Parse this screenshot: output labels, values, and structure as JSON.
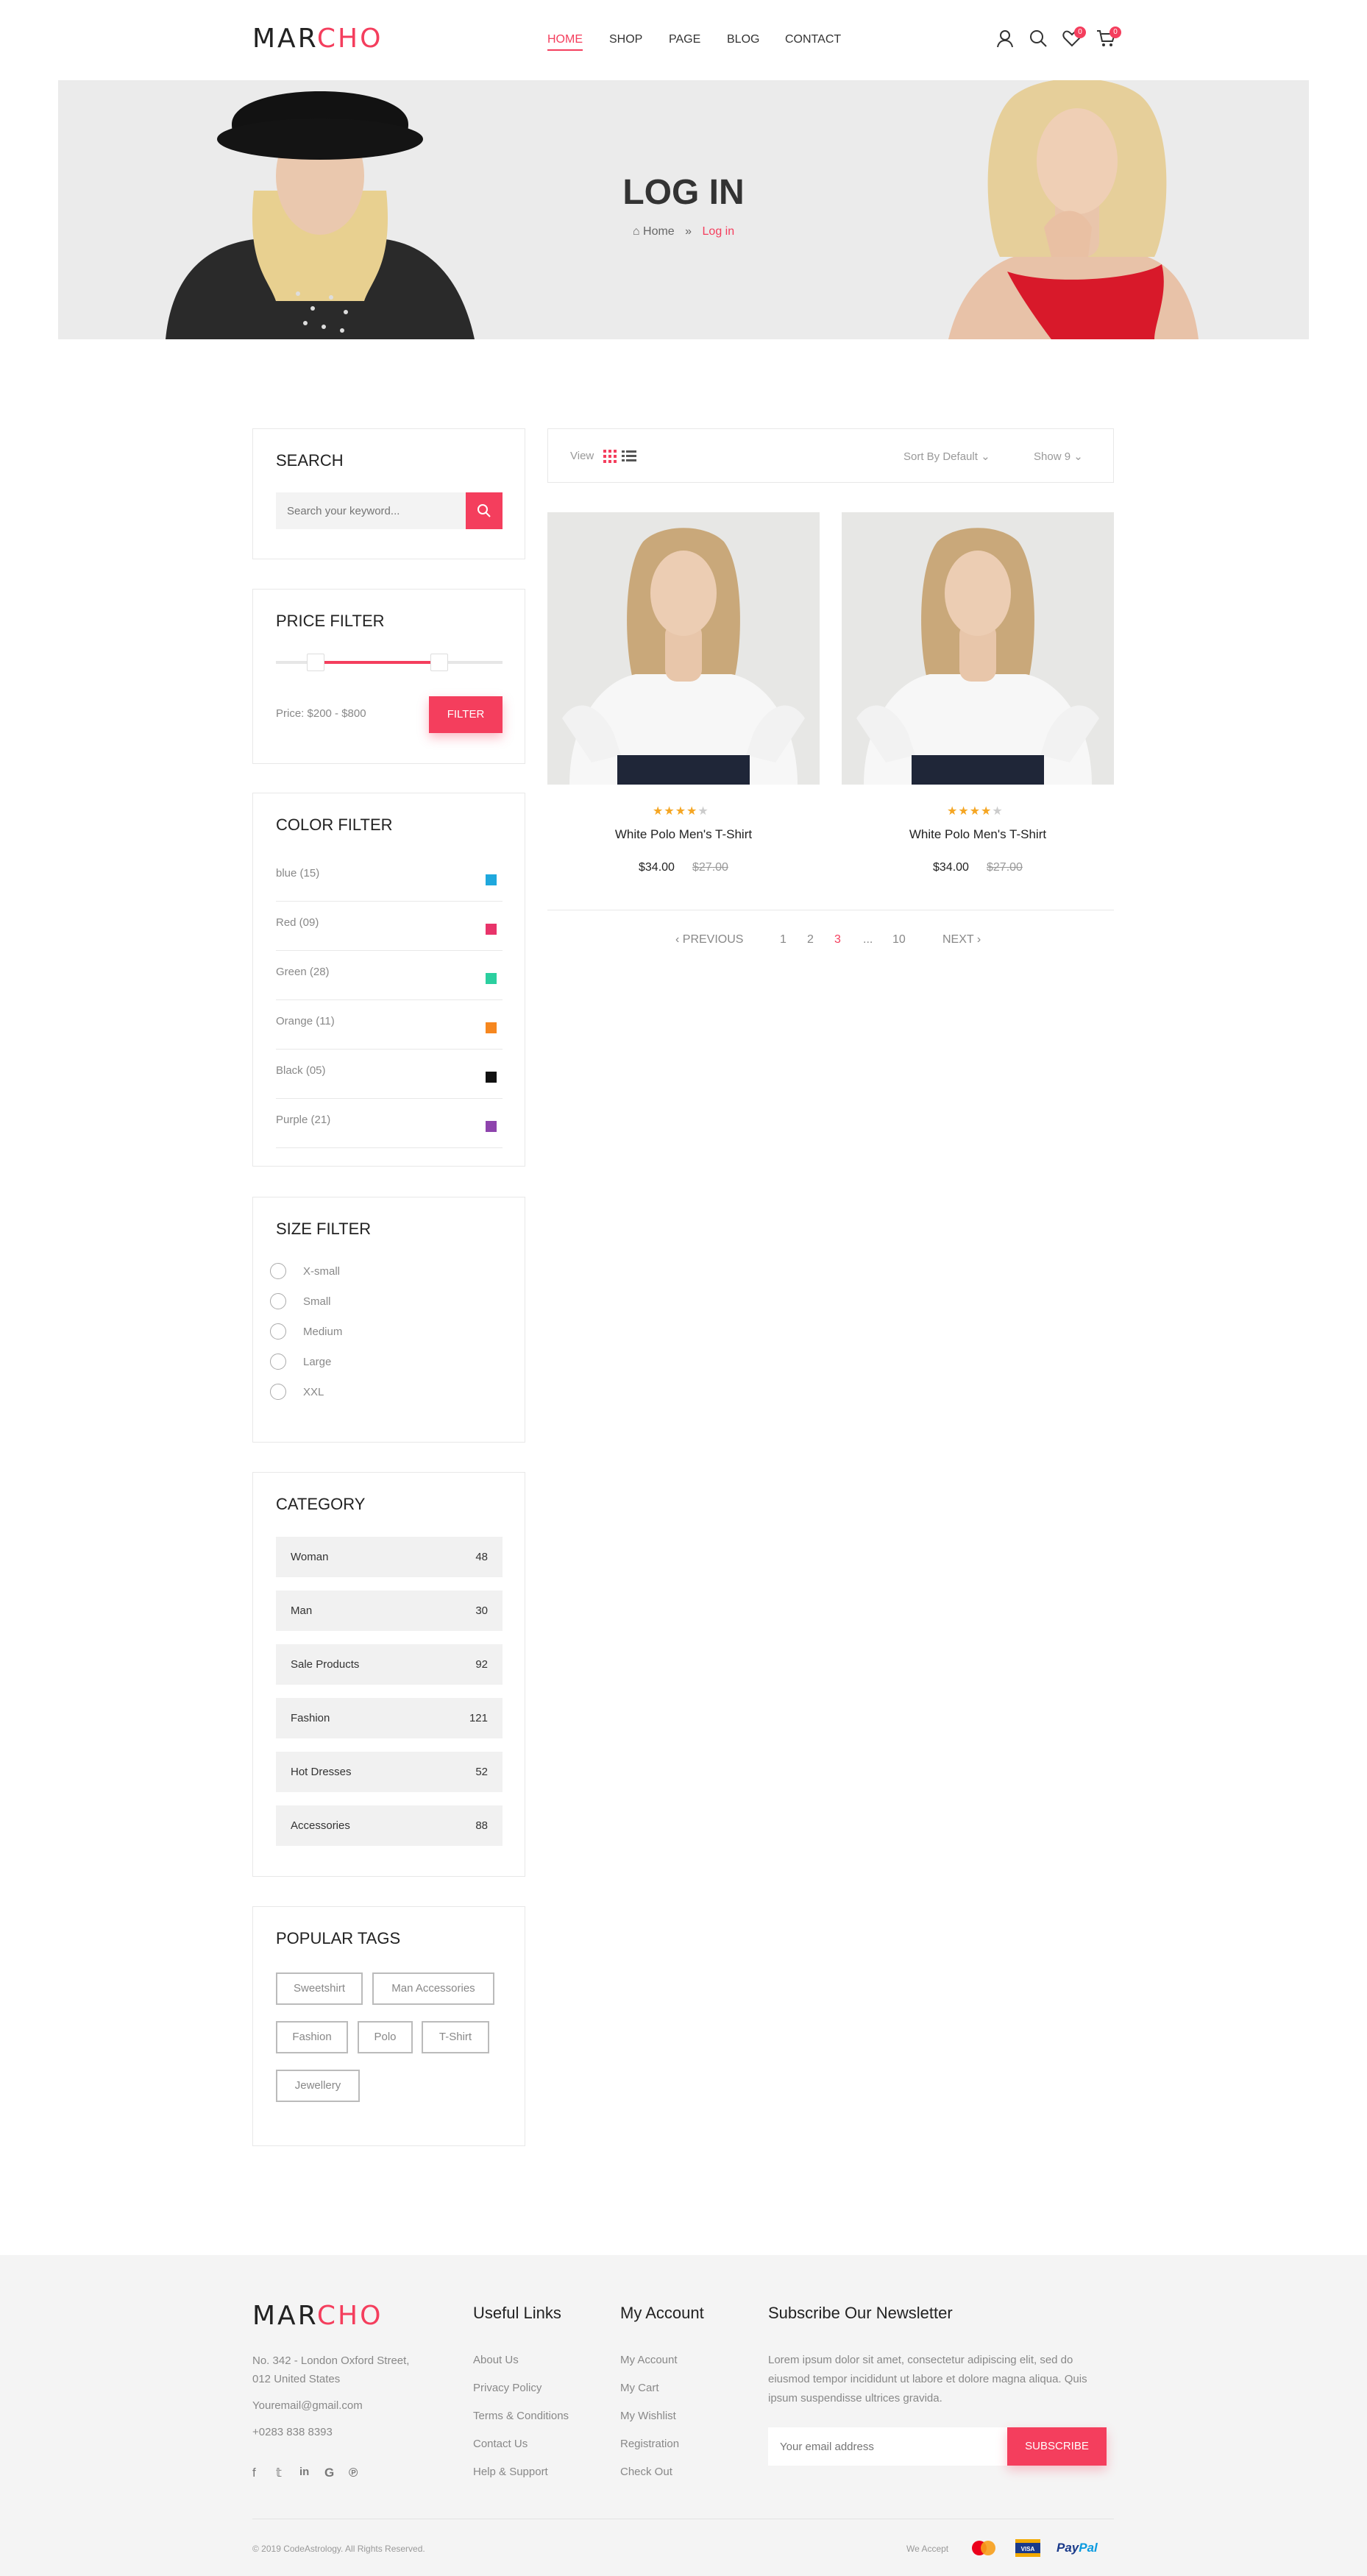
{
  "header": {
    "logo": {
      "part1": "MAR",
      "part2": "CHO"
    },
    "nav": [
      "HOME",
      "SHOP",
      "PAGE",
      "BLOG",
      "CONTACT"
    ],
    "active_nav": "HOME",
    "wishlist_count": "0",
    "cart_count": "0"
  },
  "banner": {
    "title": "LOG IN",
    "breadcrumb_home": "Home",
    "breadcrumb_current": "Log in"
  },
  "sidebar": {
    "search": {
      "title": "SEARCH",
      "placeholder": "Search your keyword..."
    },
    "price": {
      "title": "PRICE FILTER",
      "label": "Price: $200 - $800",
      "button": "FILTER",
      "range_low_fraction": 0.22,
      "range_high_fraction": 0.76
    },
    "color": {
      "title": "COLOR FILTER",
      "items": [
        {
          "label": "blue (15)",
          "color": "#1fa8dd"
        },
        {
          "label": "Red (09)",
          "color": "#e8346a"
        },
        {
          "label": "Green (28)",
          "color": "#2bcf9f"
        },
        {
          "label": "Orange (11)",
          "color": "#f6871f"
        },
        {
          "label": "Black (05)",
          "color": "#111111"
        },
        {
          "label": "Purple (21)",
          "color": "#8e44ad"
        }
      ]
    },
    "size": {
      "title": "SIZE FILTER",
      "items": [
        "X-small",
        "Small",
        "Medium",
        "Large",
        "XXL"
      ]
    },
    "category": {
      "title": "CATEGORY",
      "items": [
        {
          "name": "Woman",
          "count": "48"
        },
        {
          "name": "Man",
          "count": "30"
        },
        {
          "name": "Sale Products",
          "count": "92"
        },
        {
          "name": "Fashion",
          "count": "121"
        },
        {
          "name": "Hot Dresses",
          "count": "52"
        },
        {
          "name": "Accessories",
          "count": "88"
        }
      ]
    },
    "tags": {
      "title": "POPULAR TAGS",
      "items": [
        "Sweetshirt",
        "Man Accessories",
        "Fashion",
        "Polo",
        "T-Shirt",
        "Jewellery"
      ]
    }
  },
  "toolbar": {
    "view_label": "View",
    "sort_label": "Sort By Default",
    "show_label": "Show 9"
  },
  "products": [
    {
      "name": "White Polo Men's T-Shirt",
      "price": "$34.00",
      "old_price": "$27.00",
      "rating": 4
    },
    {
      "name": "White Polo Men's T-Shirt",
      "price": "$34.00",
      "old_price": "$27.00",
      "rating": 4
    }
  ],
  "pagination": {
    "prev": "PREVIOUS",
    "pages": [
      "1",
      "2",
      "3",
      "...",
      "10"
    ],
    "current": "3",
    "next": "NEXT"
  },
  "footer": {
    "logo": {
      "part1": "MAR",
      "part2": "CHO"
    },
    "address_line1": "No. 342 - London Oxford Street,",
    "address_line2": "012 United States",
    "email": "Youremail@gmail.com",
    "phone": "+0283 838 8393",
    "useful_links": {
      "title": "Useful Links",
      "items": [
        "About Us",
        "Privacy Policy",
        "Terms & Conditions",
        "Contact Us",
        "Help & Support"
      ]
    },
    "my_account": {
      "title": "My Account",
      "items": [
        "My Account",
        "My Cart",
        "My Wishlist",
        "Registration",
        "Check Out"
      ]
    },
    "newsletter": {
      "title": "Subscribe Our Newsletter",
      "text": "Lorem ipsum dolor sit amet, consectetur adipiscing elit, sed do eiusmod tempor incididunt ut labore et dolore magna aliqua. Quis ipsum suspendisse ultrices gravida.",
      "placeholder": "Your email address",
      "button": "SUBSCRIBE"
    },
    "copyright": "© 2019 CodeAstrology. All Rights Reserved.",
    "we_accept": "We Accept",
    "payments": [
      "MasterCard",
      "VISA",
      "PayPal"
    ]
  }
}
